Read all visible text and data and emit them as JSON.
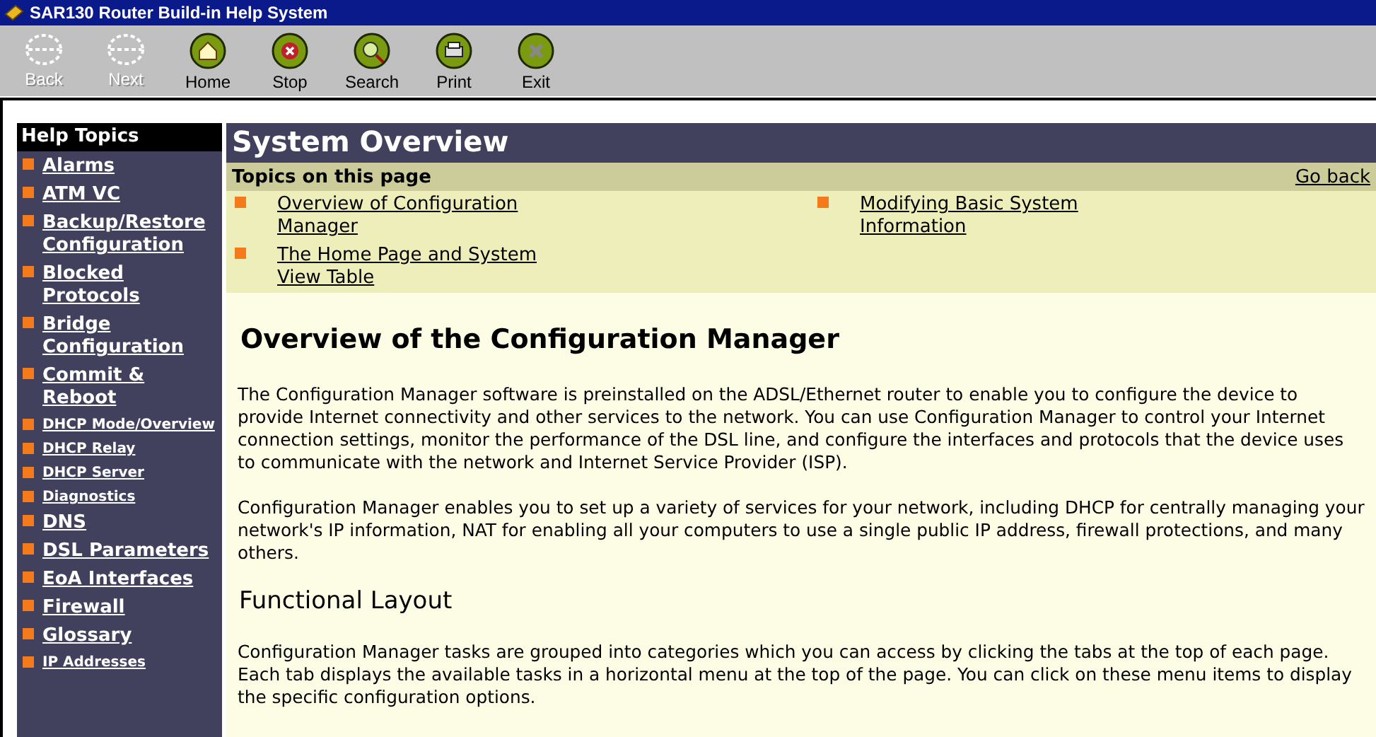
{
  "window": {
    "title": "SAR130 Router Build-in Help System"
  },
  "toolbar": [
    {
      "label": "Back",
      "kind": "back",
      "disabled": true
    },
    {
      "label": "Next",
      "kind": "next",
      "disabled": true
    },
    {
      "label": "Home",
      "kind": "home",
      "disabled": false
    },
    {
      "label": "Stop",
      "kind": "stop",
      "disabled": false
    },
    {
      "label": "Search",
      "kind": "search",
      "disabled": false
    },
    {
      "label": "Print",
      "kind": "print",
      "disabled": false
    },
    {
      "label": "Exit",
      "kind": "exit",
      "disabled": false
    }
  ],
  "sidebar": {
    "title": "Help Topics",
    "items": [
      {
        "label": "Alarms",
        "kind": "large"
      },
      {
        "label": "ATM VC",
        "kind": "large"
      },
      {
        "label": "Backup/Restore Configuration",
        "kind": "large"
      },
      {
        "label": "Blocked Protocols",
        "kind": "large"
      },
      {
        "label": "Bridge Configuration",
        "kind": "large"
      },
      {
        "label": "Commit & Reboot",
        "kind": "large"
      },
      {
        "label": "DHCP Mode/Overview",
        "kind": "small"
      },
      {
        "label": "DHCP Relay",
        "kind": "small"
      },
      {
        "label": "DHCP Server",
        "kind": "small"
      },
      {
        "label": "Diagnostics",
        "kind": "small"
      },
      {
        "label": "DNS",
        "kind": "large"
      },
      {
        "label": "DSL Parameters",
        "kind": "large"
      },
      {
        "label": "EoA Interfaces",
        "kind": "large"
      },
      {
        "label": "Firewall",
        "kind": "large"
      },
      {
        "label": "Glossary",
        "kind": "large"
      },
      {
        "label": "IP Addresses",
        "kind": "small"
      }
    ]
  },
  "page": {
    "title": "System Overview",
    "topics_heading": "Topics on this page",
    "go_back": "Go back",
    "topics": [
      "Overview of Configuration Manager",
      "Modifying Basic System Information",
      "The Home Page and System View Table"
    ],
    "sections": [
      {
        "kind": "h1",
        "text": "Overview of the Configuration Manager"
      },
      {
        "kind": "p",
        "text": "The Configuration Manager software is preinstalled on the ADSL/Ethernet router to enable you to configure the device to provide Internet connectivity and other services to the network. You can use Configuration Manager to control your Internet connection settings, monitor the performance of the DSL line, and configure the interfaces and protocols that the device uses to communicate with the network and Internet Service Provider (ISP)."
      },
      {
        "kind": "p",
        "text": "Configuration Manager enables you to set up a variety of services for your network, including DHCP for centrally managing your network's IP information, NAT for enabling all your computers to use a single public IP address, firewall protections, and many others."
      },
      {
        "kind": "h2",
        "text": "Functional Layout"
      },
      {
        "kind": "p",
        "text": "Configuration Manager tasks are grouped into categories which you can access by clicking the tabs at the top of each page. Each tab displays the available tasks in a horizontal menu at the top of the page. You can click on these menu items to display the specific configuration options."
      }
    ]
  }
}
